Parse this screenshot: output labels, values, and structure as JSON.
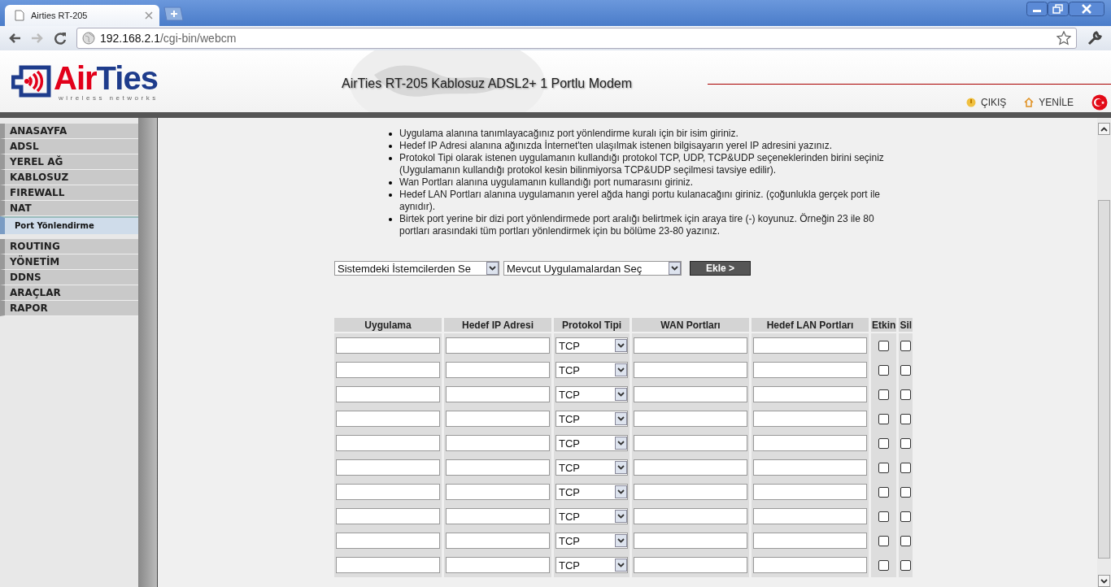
{
  "browser": {
    "tab_title": "Airties RT-205",
    "url_host": "192.168.2.1",
    "url_path": "/cgi-bin/webcm"
  },
  "header": {
    "logo_prefix": "Air",
    "logo_suffix": "Ties",
    "logo_tagline": "wireless networks",
    "title": "AirTies RT-205 Kablosuz ADSL2+ 1 Portlu Modem",
    "links": [
      {
        "kind": "logout",
        "label": "ÇIKIŞ"
      },
      {
        "kind": "refresh",
        "label": "YENİLE"
      }
    ]
  },
  "sidebar": {
    "items": [
      {
        "label": "ANASAYFA",
        "selected": false
      },
      {
        "label": "ADSL",
        "selected": false
      },
      {
        "label": "YEREL AĞ",
        "selected": false
      },
      {
        "label": "KABLOSUZ",
        "selected": false
      },
      {
        "label": "FIREWALL",
        "selected": false
      },
      {
        "label": "NAT",
        "selected": false,
        "children": [
          {
            "label": "Port Yönlendirme",
            "selected": true
          }
        ]
      },
      {
        "label": "ROUTING",
        "selected": false
      },
      {
        "label": "YÖNETİM",
        "selected": false
      },
      {
        "label": "DDNS",
        "selected": false
      },
      {
        "label": "ARAÇLAR",
        "selected": false
      },
      {
        "label": "RAPOR",
        "selected": false
      }
    ]
  },
  "instructions": [
    "Uygulama alanına tanımlayacağınız port yönlendirme kuralı için bir isim giriniz.",
    "Hedef IP Adresi alanına ağınızda İnternet'ten ulaşılmak istenen bilgisayarın yerel IP adresini yazınız.",
    "Protokol Tipi olarak istenen uygulamanın kullandığı protokol TCP, UDP, TCP&UDP seçeneklerinden birini seçiniz (Uygulamanın kullandığı protokol kesin bilinmiyorsa TCP&UDP seçilmesi tavsiye edilir).",
    "Wan Portları alanına uygulamanın kullandığı port numarasını giriniz.",
    "Hedef LAN Portları alanına uygulamanın yerel ağda hangi portu kulanacağını giriniz. (çoğunlukla gerçek port ile aynıdır).",
    "Birtek port yerine bir dizi port yönlendirmede port aralığı belirtmek için araya tire (-) koyunuz. Örneğin 23 ile 80 portları arasındaki tüm portları yönlendirmek için bu bölüme 23-80 yazınız."
  ],
  "client_select": "Sistemdeki İstemcilerden Se",
  "app_select": "Mevcut Uygulamalardan Seç",
  "add_button": "Ekle >",
  "table": {
    "columns": [
      "Uygulama",
      "Hedef IP Adresi",
      "Protokol Tipi",
      "WAN Portları",
      "Hedef LAN Portları",
      "Etkin",
      "Sil"
    ],
    "rows": [
      {
        "protocol": "TCP",
        "enabled": false,
        "delete": false
      },
      {
        "protocol": "TCP",
        "enabled": false,
        "delete": false
      },
      {
        "protocol": "TCP",
        "enabled": false,
        "delete": false
      },
      {
        "protocol": "TCP",
        "enabled": false,
        "delete": false
      },
      {
        "protocol": "TCP",
        "enabled": false,
        "delete": false
      },
      {
        "protocol": "TCP",
        "enabled": false,
        "delete": false
      },
      {
        "protocol": "TCP",
        "enabled": false,
        "delete": false
      },
      {
        "protocol": "TCP",
        "enabled": false,
        "delete": false
      },
      {
        "protocol": "TCP",
        "enabled": false,
        "delete": false
      },
      {
        "protocol": "TCP",
        "enabled": false,
        "delete": false
      }
    ]
  }
}
